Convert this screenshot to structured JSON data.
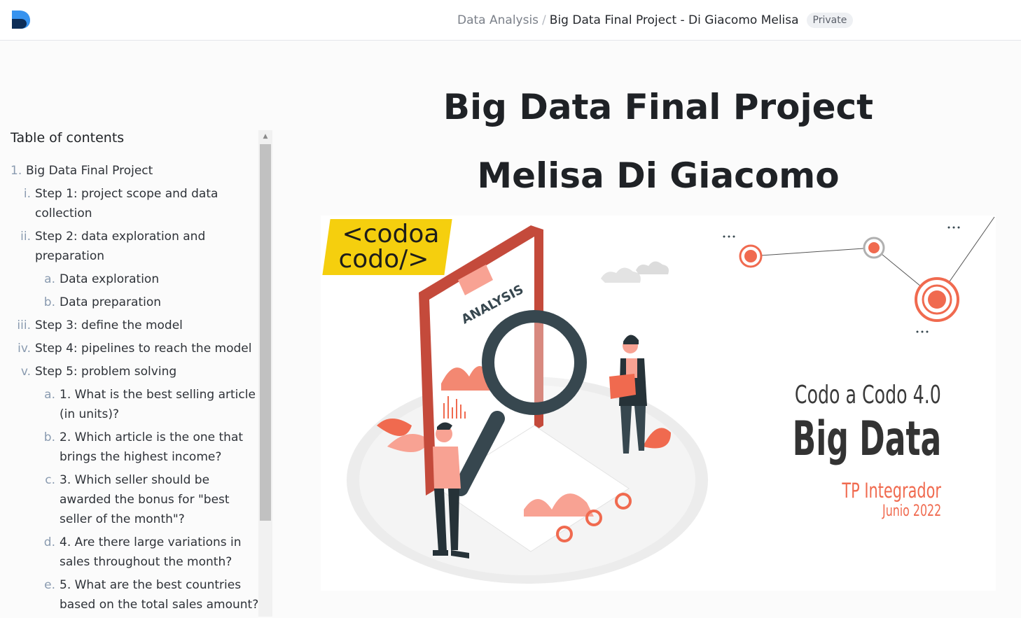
{
  "header": {
    "breadcrumb_parent": "Data Analysis",
    "breadcrumb_separator": "/",
    "breadcrumb_current": "Big Data Final Project - Di Giacomo Melisa",
    "visibility_badge": "Private",
    "logo_icon": "deepnote-logo-icon"
  },
  "sidebar": {
    "title": "Table of contents",
    "items": [
      {
        "marker": "1.",
        "label": "Big Data Final Project"
      },
      {
        "marker": "i.",
        "label": "Step 1: project scope and data collection"
      },
      {
        "marker": "ii.",
        "label": "Step 2: data exploration and preparation"
      },
      {
        "marker": "a.",
        "label": "Data exploration"
      },
      {
        "marker": "b.",
        "label": "Data preparation"
      },
      {
        "marker": "iii.",
        "label": "Step 3: define the model"
      },
      {
        "marker": "iv.",
        "label": "Step 4: pipelines to reach the model"
      },
      {
        "marker": "v.",
        "label": "Step 5: problem solving"
      },
      {
        "marker": "a.",
        "label": "1. What is the best selling article (in units)?"
      },
      {
        "marker": "b.",
        "label": "2. Which article is the one that brings the highest income?"
      },
      {
        "marker": "c.",
        "label": "3. Which seller should be awarded the bonus for \"best seller of the month\"?"
      },
      {
        "marker": "d.",
        "label": "4. Are there large variations in sales throughout the month?"
      },
      {
        "marker": "e.",
        "label": "5. What are the best countries based on the total sales amount?"
      }
    ]
  },
  "main": {
    "title": "Big Data Final Project",
    "subtitle": "Melisa Di Giacomo",
    "banner": {
      "brand_line1": "<codoa",
      "brand_line2": "codo/>",
      "clipboard_text": "ANALYSIS",
      "course_line1": "Codo a Codo 4.0",
      "course_line2": "Big Data",
      "course_line3": "TP Integrador",
      "course_line4": "Junio 2022",
      "colors": {
        "accent": "#f06a4f",
        "yellow": "#f5cf0e",
        "dark": "#37474f"
      }
    }
  }
}
